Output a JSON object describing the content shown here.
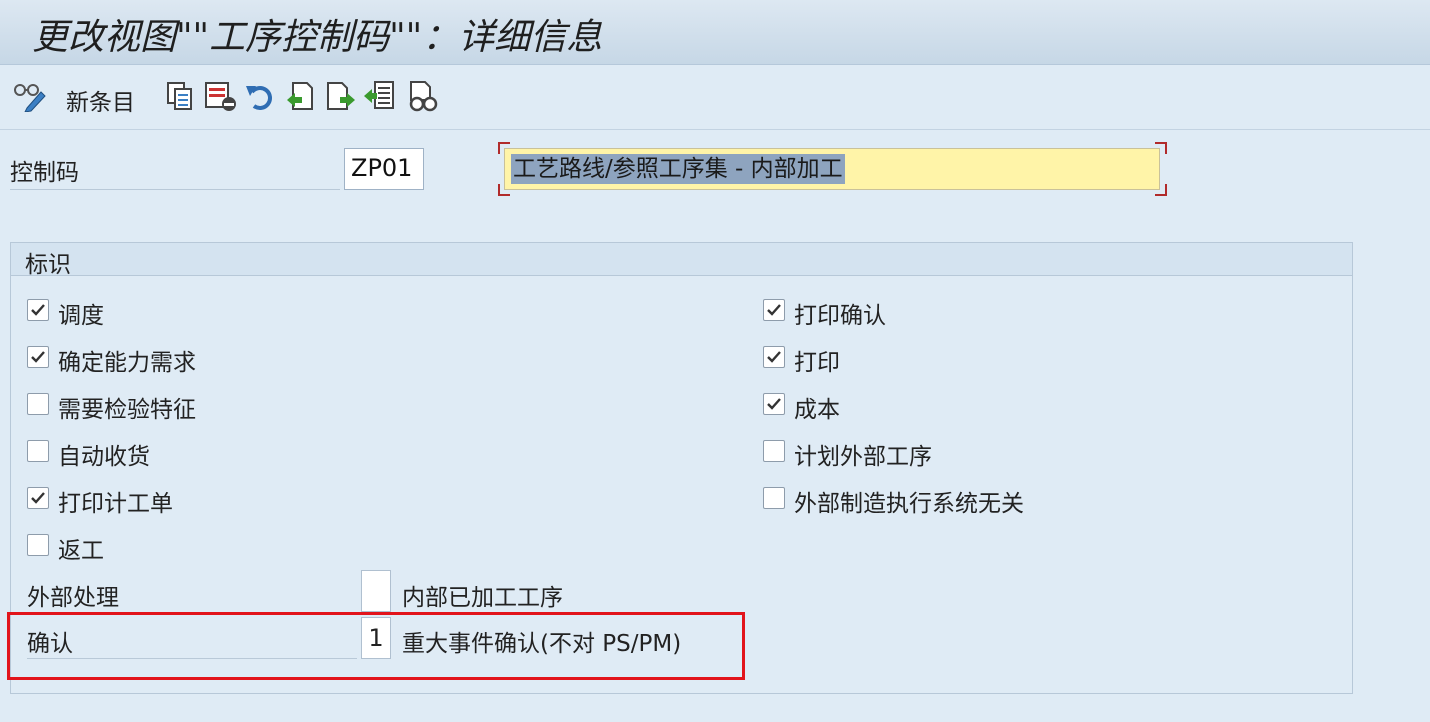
{
  "window": {
    "title": "更改视图\"\"工序控制码\"\"：详细信息"
  },
  "toolbar": {
    "new_entries_label": "新条目",
    "icons": [
      "glasses-pencil-icon",
      "copy-icon",
      "delete-icon",
      "undo-icon",
      "previous-entry-icon",
      "next-entry-icon",
      "transport-icon",
      "find-icon"
    ]
  },
  "header": {
    "control_key_label": "控制码",
    "control_key_value": "ZP01",
    "description_selected": "工艺路线/参照工序集 - 内部加",
    "description_tail": "工"
  },
  "group": {
    "title": "标识",
    "left_checkboxes": [
      {
        "label": "调度",
        "checked": true
      },
      {
        "label": "确定能力需求",
        "checked": true
      },
      {
        "label": "需要检验特征",
        "checked": false
      },
      {
        "label": "自动收货",
        "checked": false
      },
      {
        "label": "打印计工单",
        "checked": true
      },
      {
        "label": "返工",
        "checked": false
      }
    ],
    "right_checkboxes": [
      {
        "label": "打印确认",
        "checked": true
      },
      {
        "label": "打印",
        "checked": true
      },
      {
        "label": "成本",
        "checked": true
      },
      {
        "label": "计划外部工序",
        "checked": false
      },
      {
        "label": "外部制造执行系统无关",
        "checked": false
      }
    ],
    "external_processing": {
      "label": "外部处理",
      "value": "",
      "description": "内部已加工工序"
    },
    "confirmation": {
      "label": "确认",
      "value": "1",
      "description": "重大事件确认(不对 PS/PM)"
    }
  },
  "colors": {
    "highlight": "#e2141b",
    "background": "#dfebf5",
    "description_bg": "#fff4a8"
  }
}
